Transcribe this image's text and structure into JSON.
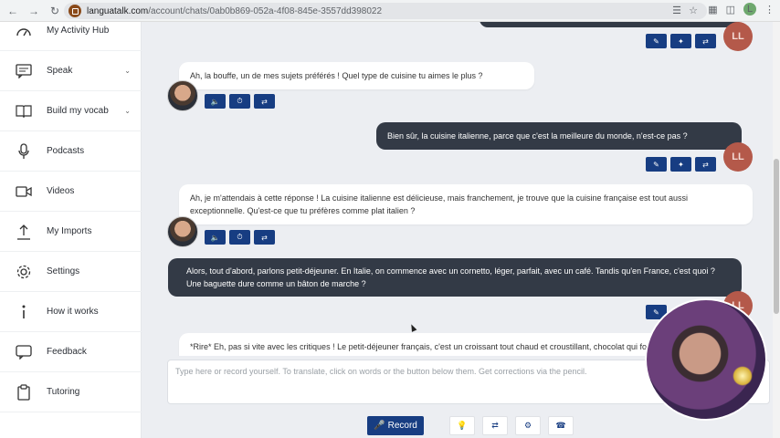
{
  "browser": {
    "url_host": "languatalk.com",
    "url_path": "/account/chats/0ab0b869-052a-4f08-845e-3557dd398022",
    "profile_initial": "L"
  },
  "sidebar": {
    "items": [
      {
        "label": "My Activity Hub",
        "icon": "activity-icon"
      },
      {
        "label": "Speak",
        "icon": "speech-bubble-icon",
        "has_chevron": true
      },
      {
        "label": "Build my vocab",
        "icon": "book-icon",
        "has_chevron": true
      },
      {
        "label": "Podcasts",
        "icon": "microphone-icon"
      },
      {
        "label": "Videos",
        "icon": "video-icon"
      },
      {
        "label": "My Imports",
        "icon": "upload-icon"
      },
      {
        "label": "Settings",
        "icon": "gear-icon"
      },
      {
        "label": "How it works",
        "icon": "info-icon"
      },
      {
        "label": "Feedback",
        "icon": "feedback-icon"
      },
      {
        "label": "Tutoring",
        "icon": "clipboard-icon"
      }
    ]
  },
  "chat": {
    "user_initials": "LL",
    "messages": [
      {
        "role": "ai",
        "text": "Ah, la bouffe, un de mes sujets préférés ! Quel type de cuisine tu aimes le plus ?"
      },
      {
        "role": "user",
        "text": "Bien sûr, la cuisine italienne, parce que c'est la meilleure du monde, n'est-ce pas ?"
      },
      {
        "role": "ai",
        "text": "Ah, je m'attendais à cette réponse ! La cuisine italienne est délicieuse, mais franchement, je trouve que la cuisine française est tout aussi exceptionnelle. Qu'est-ce que tu préfères comme plat italien ?"
      },
      {
        "role": "user",
        "text": "Alors, tout d'abord, parlons petit-déjeuner. En Italie, on commence avec un cornetto, léger, parfait, avec un café. Tandis qu'en France, c'est quoi ? Une baguette dure comme un bâton de marche ?"
      },
      {
        "role": "ai",
        "text": "*Rire* Eh, pas si vite avec les critiques ! Le petit-déjeuner français, c'est un croissant tout chaud et croustillant, chocolat qui fondent dans la bouche... certainement pas une baguette rassis. Comment tu peux comparer ça"
      }
    ]
  },
  "composer": {
    "placeholder": "Type here or record yourself. To translate, click on words or the button below them. Get corrections via the pencil.",
    "record_label": "Record"
  }
}
